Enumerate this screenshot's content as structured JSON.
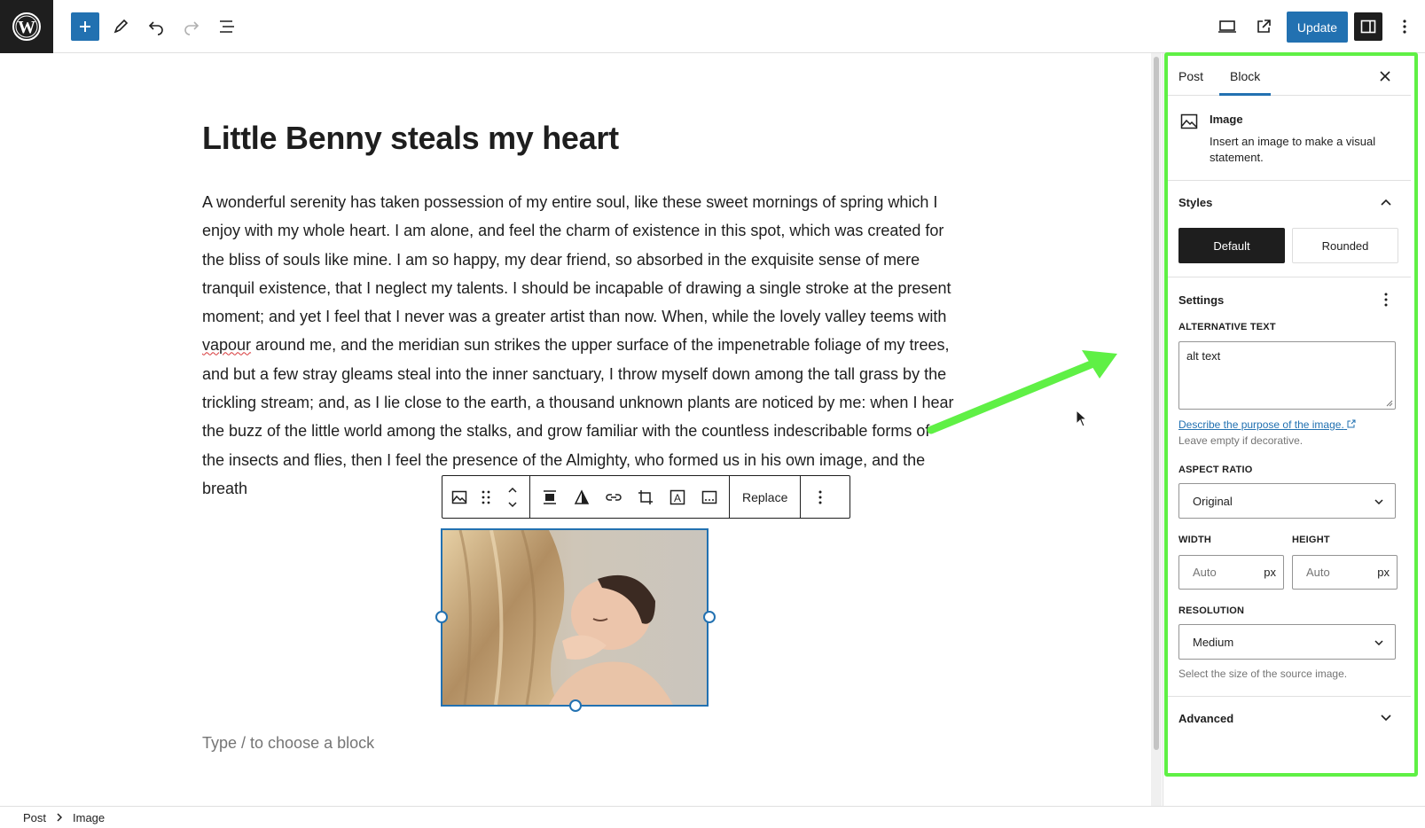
{
  "toolbar": {
    "update_label": "Update"
  },
  "post": {
    "title": "Little Benny steals my heart",
    "body_before": "A wonderful serenity has taken possession of my entire soul, like these sweet mornings of spring which I enjoy with my whole heart. I am alone, and feel the charm of existence in this spot, which was created for the bliss of souls like mine. I am so happy, my dear friend, so absorbed in the exquisite sense of mere tranquil existence, that I neglect my talents. I should be incapable of drawing a single stroke at the present moment; and yet I feel that I never was a greater artist than now. When, while the lovely valley teems with ",
    "body_spell": "vapour",
    "body_after": " around me, and the meridian sun strikes the upper surface of the impenetrable foliage of my trees, and but a few stray gleams steal into the inner sanctuary, I throw myself down among the tall grass by the trickling stream; and, as I lie close to the earth, a thousand unknown plants are noticed by me: when I hear the buzz of the little world among the stalks, and grow familiar with the countless indescribable forms of the insects and flies, then I feel the presence of the Almighty, who formed us in his own image, and the breath",
    "placeholder": "Type / to choose a block"
  },
  "block_toolbar": {
    "replace_label": "Replace"
  },
  "sidebar": {
    "tabs": [
      {
        "label": "Post",
        "active": false
      },
      {
        "label": "Block",
        "active": true
      }
    ],
    "block_card": {
      "title": "Image",
      "description": "Insert an image to make a visual statement."
    },
    "styles": {
      "heading": "Styles",
      "options": [
        "Default",
        "Rounded"
      ],
      "selected": "Default"
    },
    "settings": {
      "heading": "Settings",
      "alt_label": "ALTERNATIVE TEXT",
      "alt_value": "alt text",
      "alt_link": "Describe the purpose of the image.",
      "alt_help": "Leave empty if decorative.",
      "aspect_label": "ASPECT RATIO",
      "aspect_value": "Original",
      "width_label": "WIDTH",
      "height_label": "HEIGHT",
      "width_placeholder": "Auto",
      "height_placeholder": "Auto",
      "unit": "px",
      "resolution_label": "RESOLUTION",
      "resolution_value": "Medium",
      "resolution_help": "Select the size of the source image."
    },
    "advanced": {
      "heading": "Advanced"
    }
  },
  "breadcrumb": [
    "Post",
    "Image"
  ],
  "colors": {
    "accent": "#2271b1",
    "annotation": "#5ff045",
    "dark": "#1e1e1e"
  }
}
